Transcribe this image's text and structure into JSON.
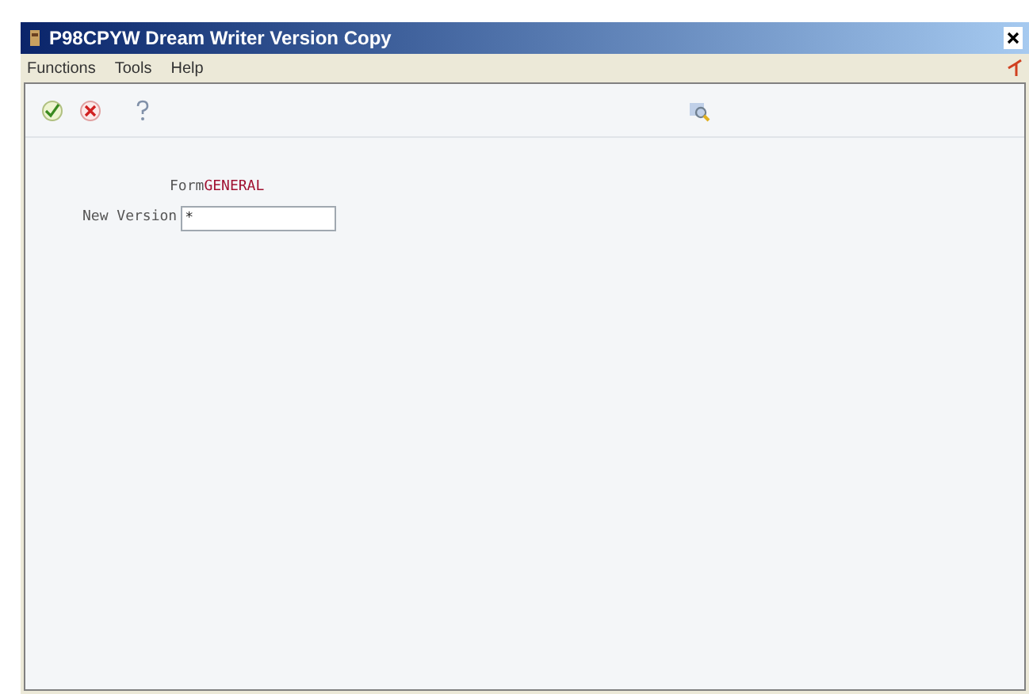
{
  "window": {
    "title": "P98CPYW  Dream Writer Version Copy"
  },
  "menu": [
    "Functions",
    "Tools",
    "Help"
  ],
  "form": {
    "label": "Form",
    "name": "GENERAL"
  },
  "fields": [
    {
      "label": "New Version",
      "value": "*"
    }
  ]
}
